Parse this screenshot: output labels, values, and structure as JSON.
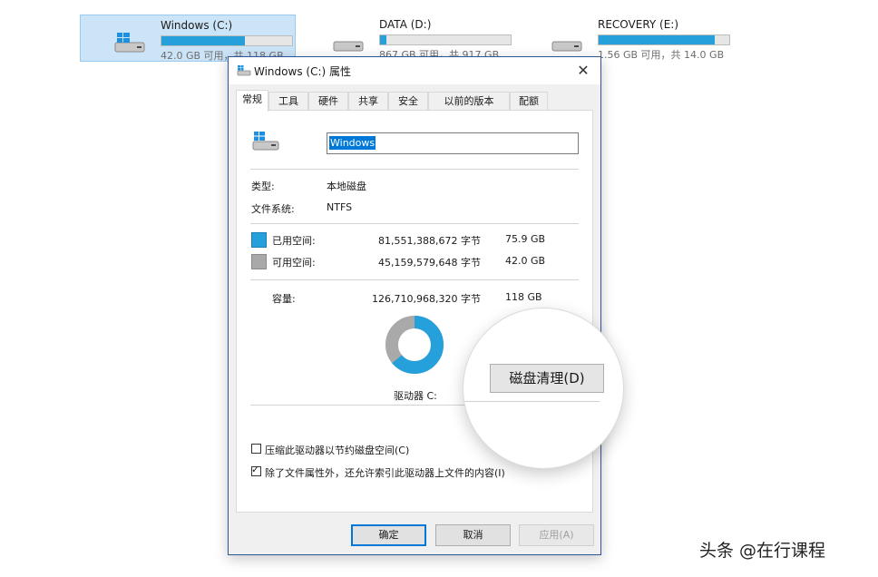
{
  "explorer": {
    "drives": [
      {
        "name": "Windows (C:)",
        "info": "42.0 GB 可用，共 118 GB",
        "used_fraction": 0.64
      },
      {
        "name": "DATA (D:)",
        "info": "867 GB 可用，共 917 GB",
        "used_fraction": 0.05
      },
      {
        "name": "RECOVERY (E:)",
        "info": "1.56 GB 可用，共 14.0 GB",
        "used_fraction": 0.89
      }
    ]
  },
  "dialog": {
    "title": "Windows (C:) 属性",
    "close_glyph": "✕",
    "tabs": [
      "常规",
      "工具",
      "硬件",
      "共享",
      "安全",
      "以前的版本",
      "配额"
    ],
    "volume_name": "Windows",
    "type_label": "类型:",
    "type_value": "本地磁盘",
    "fs_label": "文件系统:",
    "fs_value": "NTFS",
    "used": {
      "label": "已用空间:",
      "bytes": "81,551,388,672 字节",
      "size": "75.9 GB"
    },
    "free": {
      "label": "可用空间:",
      "bytes": "45,159,579,648 字节",
      "size": "42.0 GB"
    },
    "capacity": {
      "label": "容量:",
      "bytes": "126,710,968,320 字节",
      "size": "118 GB"
    },
    "pie": {
      "used_fraction": 0.64
    },
    "drive_label": "驱动器 C:",
    "compress_label": "压缩此驱动器以节约磁盘空间(C)",
    "compress_checked": false,
    "index_label": "除了文件属性外，还允许索引此驱动器上文件的内容(I)",
    "index_checked": true,
    "check_glyph": "✓",
    "buttons": {
      "ok": "确定",
      "cancel": "取消",
      "apply": "应用(A)"
    }
  },
  "magnifier": {
    "cleanup_button": "磁盘清理(D)"
  },
  "watermark": "头条 @在行课程",
  "colors": {
    "used": "#26a0da",
    "free": "#a9a9a9",
    "selection": "#0078d7",
    "dialog_border": "#2b579a"
  }
}
